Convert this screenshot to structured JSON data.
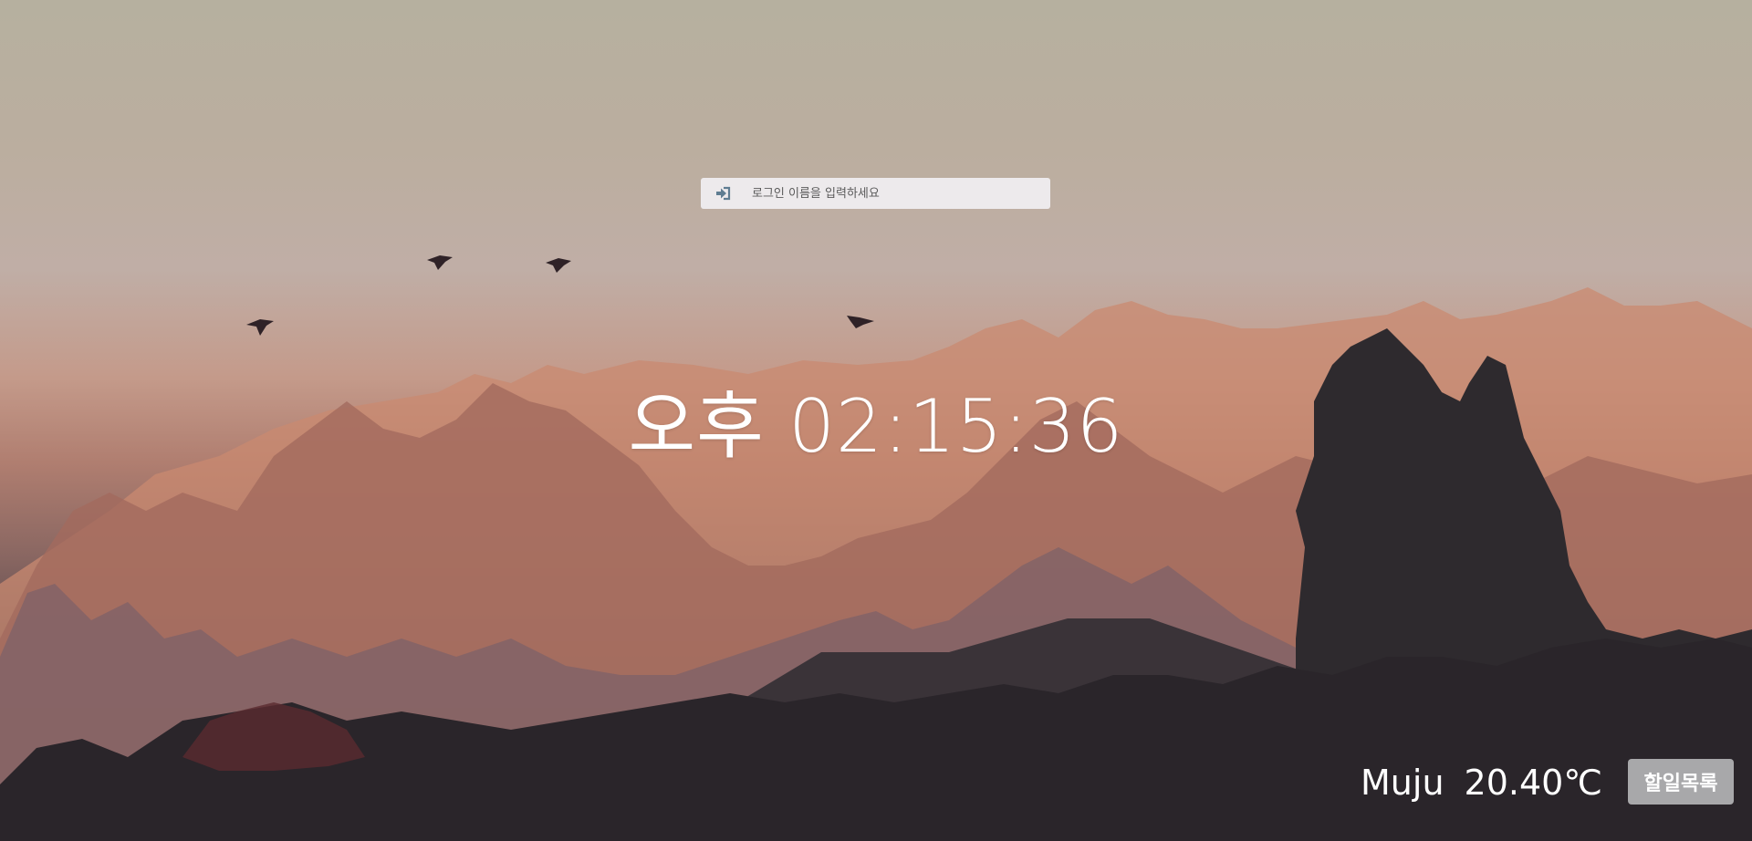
{
  "login": {
    "icon": "sign-in-icon",
    "placeholder": "로그인 이름을 입력하세요",
    "value": ""
  },
  "clock": {
    "text": "오후 02:15:36"
  },
  "weather": {
    "city": "Muju",
    "temperature": "20.40℃"
  },
  "todo": {
    "label": "할일목록"
  },
  "colors": {
    "sky_top": "#b6b09f",
    "forest_dark": "#2b262b",
    "button_bg": "#a8a8aa",
    "icon_color": "#5f7d92"
  }
}
